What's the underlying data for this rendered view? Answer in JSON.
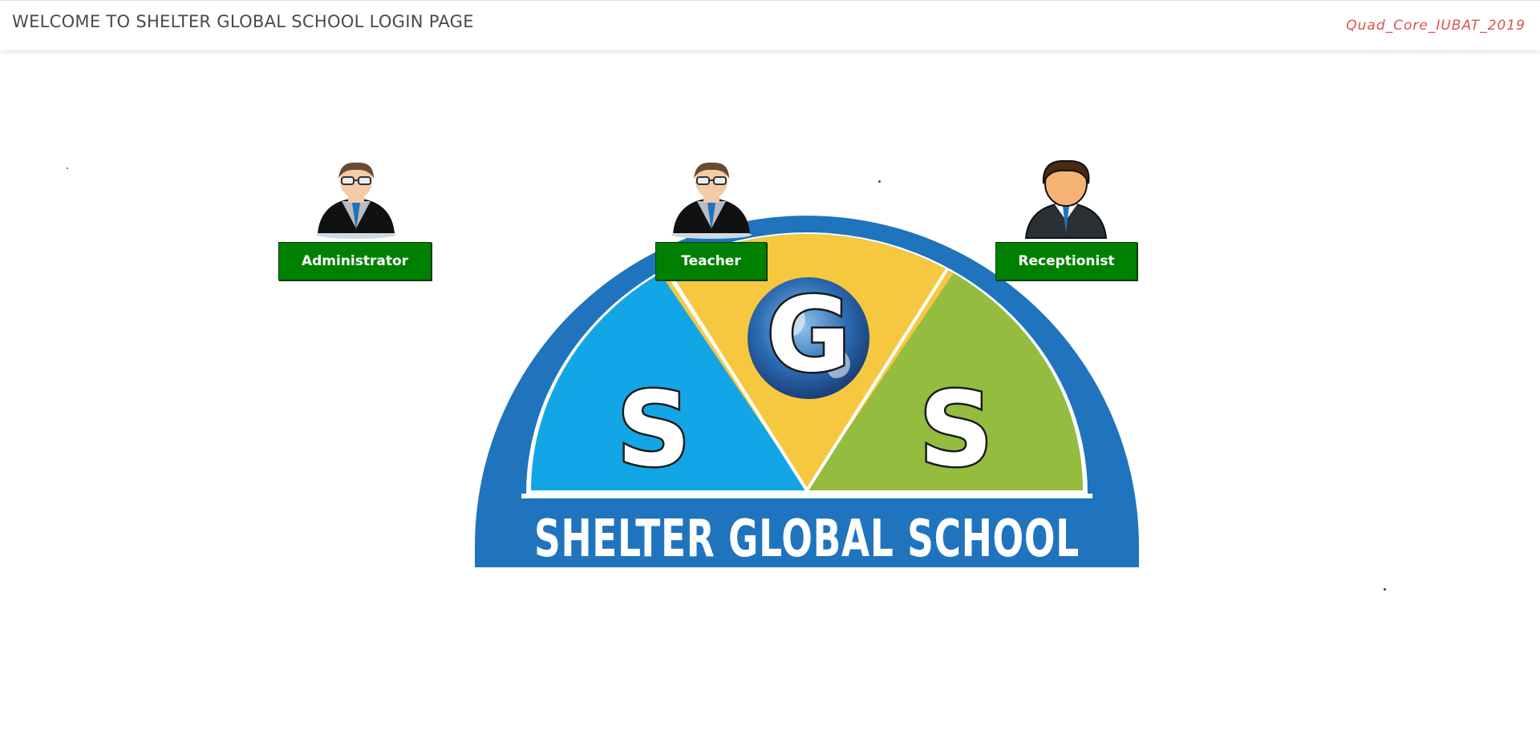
{
  "header": {
    "title": "WELCOME TO SHELTER GLOBAL SCHOOL LOGIN PAGE",
    "credit": "Quad_Core_IUBAT_2019"
  },
  "logo": {
    "name": "SHELTER GLOBAL SCHOOL",
    "letters": [
      "S",
      "G",
      "S"
    ],
    "colors": {
      "outer_ring": "#1f74bd",
      "left_segment": "#13a6e6",
      "middle_segment": "#f6c83f",
      "right_segment": "#94bc3e",
      "globe": "#2c6db3"
    }
  },
  "roles": [
    {
      "label": "Administrator",
      "avatar": "admin-avatar-icon"
    },
    {
      "label": "Teacher",
      "avatar": "teacher-avatar-icon"
    },
    {
      "label": "Receptionist",
      "avatar": "receptionist-avatar-icon"
    }
  ],
  "colors": {
    "button_bg": "#008000",
    "credit_text": "#d9534f"
  }
}
